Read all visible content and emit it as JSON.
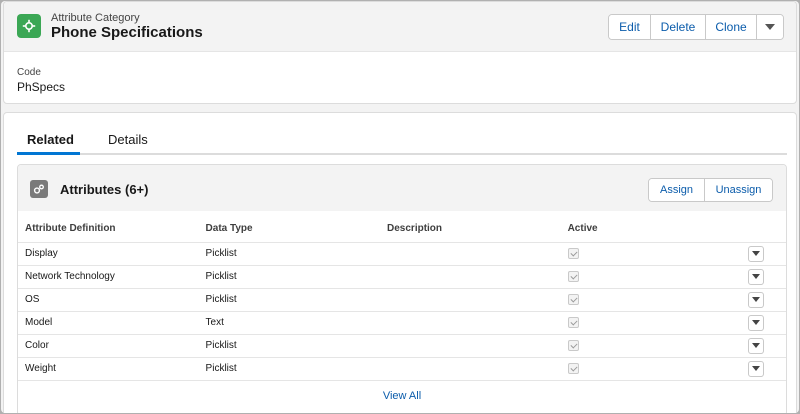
{
  "record": {
    "type_label": "Attribute Category",
    "title": "Phone Specifications",
    "code_label": "Code",
    "code_value": "PhSpecs"
  },
  "actions": {
    "edit": "Edit",
    "delete": "Delete",
    "clone": "Clone"
  },
  "tabs": {
    "related": "Related",
    "details": "Details"
  },
  "attributes": {
    "title": "Attributes (6+)",
    "assign": "Assign",
    "unassign": "Unassign",
    "columns": {
      "definition": "Attribute Definition",
      "data_type": "Data Type",
      "description": "Description",
      "active": "Active"
    },
    "rows": [
      {
        "name": "Display",
        "data_type": "Picklist",
        "description": ""
      },
      {
        "name": "Network Technology",
        "data_type": "Picklist",
        "description": ""
      },
      {
        "name": "OS",
        "data_type": "Picklist",
        "description": ""
      },
      {
        "name": "Model",
        "data_type": "Text",
        "description": ""
      },
      {
        "name": "Color",
        "data_type": "Picklist",
        "description": ""
      },
      {
        "name": "Weight",
        "data_type": "Picklist",
        "description": ""
      }
    ],
    "view_all": "View All"
  },
  "colors": {
    "accent": "#0176d3",
    "link": "#0b5cab",
    "record_icon": "#3ba755"
  },
  "icons": {
    "record": "attribute-category-icon",
    "attributes": "attributes-gears-icon"
  }
}
